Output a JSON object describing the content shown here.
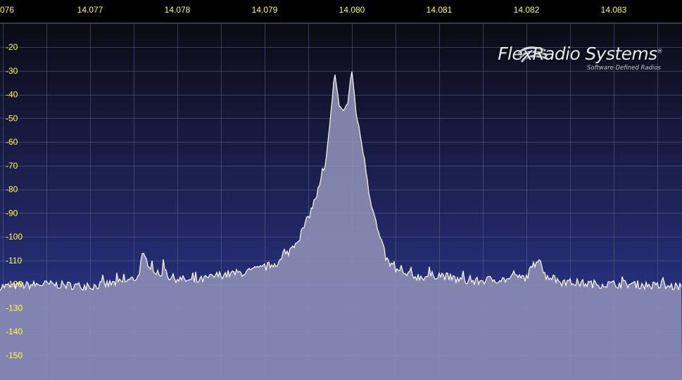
{
  "panadapter": {
    "background_top": "#0b0b14",
    "background_bottom": "#27307a",
    "grid_color": "#5c6288",
    "frequency_label_color": "#ffff3a",
    "dbm_label_color": "#ffff3a",
    "spectrum_fill": "#8c8eb4",
    "spectrum_line": "#ffffff",
    "frequency_labels": [
      {
        "label": "076",
        "mhz": 14.076
      },
      {
        "label": "14.077",
        "mhz": 14.077
      },
      {
        "label": "14.078",
        "mhz": 14.078
      },
      {
        "label": "14.079",
        "mhz": 14.079
      },
      {
        "label": "14.080",
        "mhz": 14.08
      },
      {
        "label": "14.081",
        "mhz": 14.081
      },
      {
        "label": "14.082",
        "mhz": 14.082
      },
      {
        "label": "14.083",
        "mhz": 14.083
      }
    ],
    "dbm_labels": [
      "-20",
      "-30",
      "-40",
      "-50",
      "-60",
      "-70",
      "-80",
      "-90",
      "-100",
      "-110",
      "-120",
      "-130",
      "-140",
      "-150"
    ],
    "dbm_values": [
      -20,
      -30,
      -40,
      -50,
      -60,
      -70,
      -80,
      -90,
      -100,
      -110,
      -120,
      -130,
      -140,
      -150
    ],
    "logo": {
      "name": "FlexRadio Systems",
      "trademark": "®",
      "tagline": "Software Defined Radios"
    }
  },
  "chart_data": {
    "type": "area",
    "xlabel": "",
    "ylabel": "",
    "xlim": [
      14.076,
      14.0838
    ],
    "ylim": [
      -157,
      -13
    ],
    "grid": true,
    "x_unit": "MHz",
    "y_unit": "dBm",
    "noise_floor": -121,
    "series": [
      {
        "x": [
          14.076,
          14.0765,
          14.077,
          14.0774,
          14.07755,
          14.0776,
          14.0778,
          14.07785,
          14.0779,
          14.0782,
          14.0785,
          14.0788,
          14.079,
          14.0792,
          14.0794,
          14.0795,
          14.0796,
          14.0797,
          14.07975,
          14.0798,
          14.07985,
          14.0799,
          14.07995,
          14.08,
          14.08005,
          14.0801,
          14.08015,
          14.0802,
          14.0803,
          14.0804,
          14.0805,
          14.0806,
          14.0808,
          14.081,
          14.0812,
          14.0814,
          14.0816,
          14.0818,
          14.082,
          14.08215,
          14.0822,
          14.0824,
          14.0828,
          14.0832,
          14.0836,
          14.0838
        ],
        "values": [
          -121,
          -120,
          -121,
          -119,
          -117,
          -108,
          -117,
          -112,
          -117,
          -119,
          -116,
          -115,
          -113,
          -110,
          -100,
          -92,
          -82,
          -70,
          -52,
          -30,
          -44,
          -47,
          -44,
          -30,
          -48,
          -58,
          -68,
          -82,
          -98,
          -110,
          -114,
          -116,
          -117,
          -116,
          -118,
          -119,
          -118,
          -118,
          -117,
          -108,
          -116,
          -119,
          -120,
          -120,
          -121,
          -121
        ]
      }
    ]
  }
}
